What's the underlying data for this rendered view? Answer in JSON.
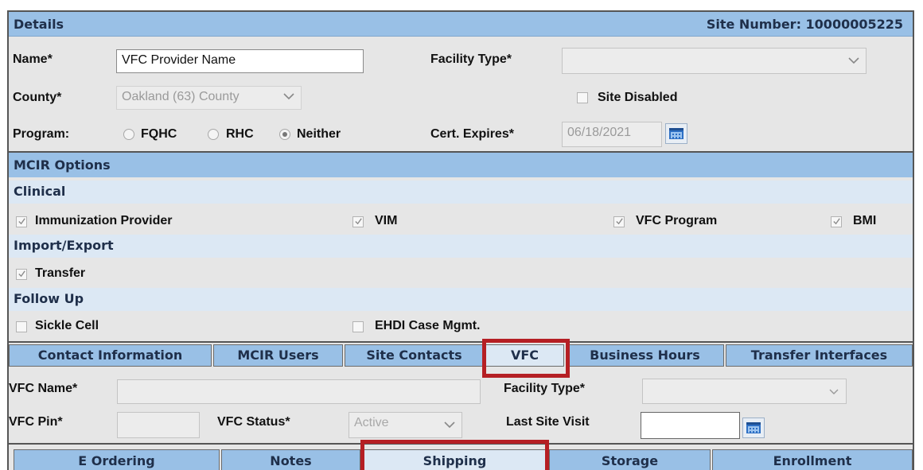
{
  "details": {
    "header": "Details",
    "site_number": "Site Number: 10000005225",
    "name_label": "Name*",
    "name_value": "VFC Provider Name",
    "facility_type_label": "Facility Type*",
    "facility_type_value": "",
    "county_label": "County*",
    "county_value": "Oakland (63) County",
    "site_disabled_label": "Site Disabled",
    "program_label": "Program:",
    "program_options": [
      "FQHC",
      "RHC",
      "Neither"
    ],
    "program_selected": "Neither",
    "cert_expires_label": "Cert. Expires*",
    "cert_expires_value": "06/18/2021"
  },
  "mcir_options": {
    "header": "MCIR Options",
    "clinical": {
      "header": "Clinical",
      "items": [
        "Immunization Provider",
        "VIM",
        "VFC Program",
        "BMI"
      ]
    },
    "import_export": {
      "header": "Import/Export",
      "items": [
        "Transfer"
      ]
    },
    "follow_up": {
      "header": "Follow Up",
      "items": [
        "Sickle Cell",
        "EHDI Case Mgmt."
      ]
    }
  },
  "tabs": [
    "Contact Information",
    "MCIR Users",
    "Site Contacts",
    "VFC",
    "Business Hours",
    "Transfer Interfaces"
  ],
  "active_tab": "VFC",
  "vfc": {
    "name_label": "VFC Name*",
    "name_value": "",
    "facility_type_label": "Facility Type*",
    "facility_type_value": "",
    "pin_label": "VFC Pin*",
    "pin_value": "",
    "status_label": "VFC Status*",
    "status_value": "Active",
    "last_visit_label": "Last Site Visit",
    "last_visit_value": ""
  },
  "subtabs": [
    "E Ordering",
    "Notes",
    "Shipping",
    "Storage",
    "Enrollment"
  ],
  "active_subtab": "Shipping",
  "colors": {
    "header_blue": "#99c0e6",
    "light_blue": "#dce8f4",
    "highlight_red": "#b51f24",
    "panel_gray": "#e6e6e6"
  }
}
